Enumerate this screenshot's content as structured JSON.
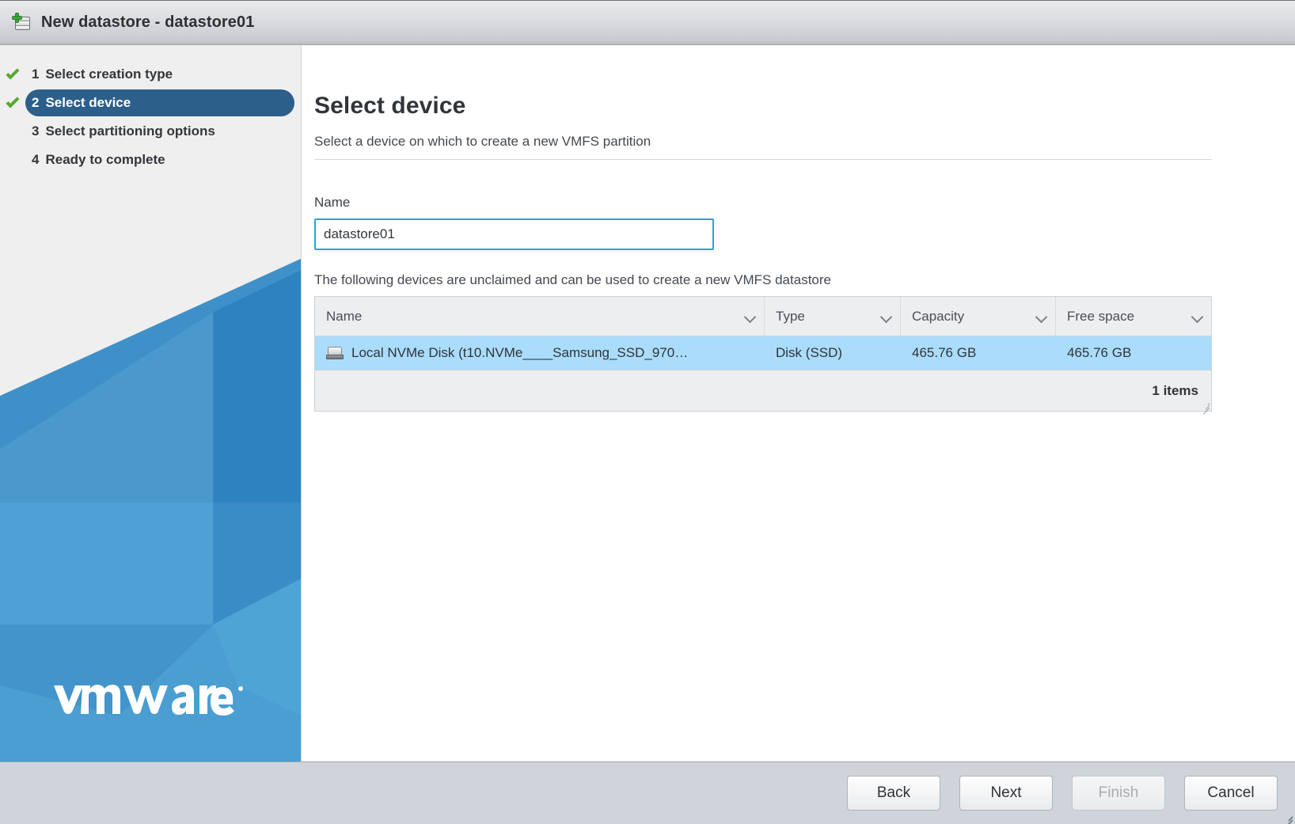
{
  "window": {
    "title": "New datastore - datastore01",
    "icon": "new-datastore-icon"
  },
  "wizard": {
    "steps": [
      {
        "number": "1",
        "label": "Select creation type",
        "completed": true,
        "active": false
      },
      {
        "number": "2",
        "label": "Select device",
        "completed": true,
        "active": true
      },
      {
        "number": "3",
        "label": "Select partitioning options",
        "completed": false,
        "active": false
      },
      {
        "number": "4",
        "label": "Ready to complete",
        "completed": false,
        "active": false
      }
    ],
    "brand": "vmware"
  },
  "page": {
    "title": "Select device",
    "subtitle": "Select a device on which to create a new VMFS partition",
    "name_label": "Name",
    "name_value": "datastore01",
    "name_placeholder": "",
    "table_caption": "The following devices are unclaimed and can be used to create a new VMFS datastore"
  },
  "table": {
    "columns": [
      {
        "key": "name",
        "label": "Name"
      },
      {
        "key": "type",
        "label": "Type"
      },
      {
        "key": "capacity",
        "label": "Capacity"
      },
      {
        "key": "free_space",
        "label": "Free space"
      }
    ],
    "rows": [
      {
        "icon": "disk-icon",
        "name": "Local NVMe Disk (t10.NVMe____Samsung_SSD_970…",
        "type": "Disk (SSD)",
        "capacity": "465.76 GB",
        "free_space": "465.76 GB",
        "selected": true
      }
    ],
    "items_count": "1 items"
  },
  "footer": {
    "back_label": "Back",
    "next_label": "Next",
    "finish_label": "Finish",
    "cancel_label": "Cancel",
    "finish_disabled": true
  },
  "colors": {
    "accent_blue": "#2d5f8b",
    "focus_border": "#49afdb",
    "row_selected": "#aadcfb",
    "check_green": "#5aa832",
    "brand_blue": "#3a8dc8"
  }
}
